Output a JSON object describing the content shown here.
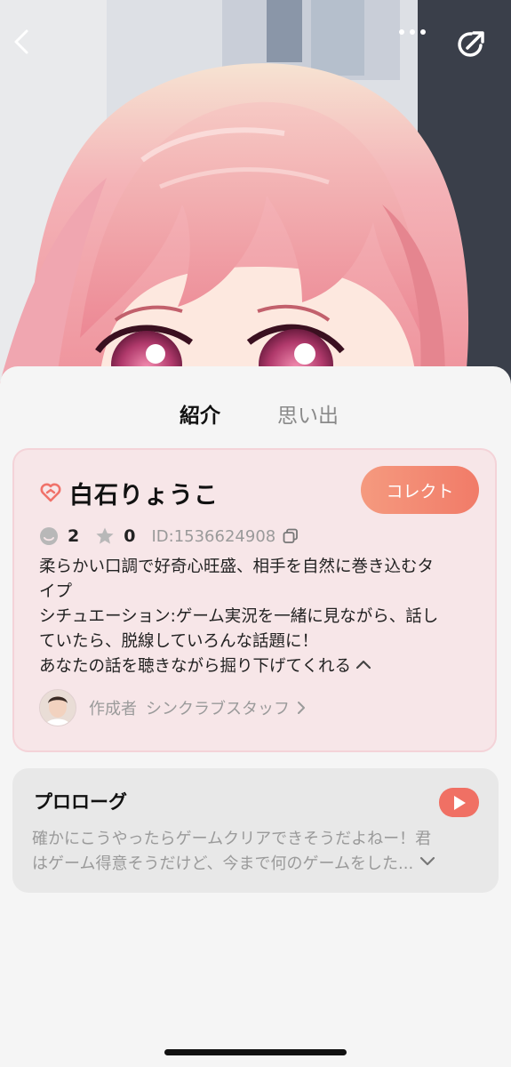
{
  "header": {
    "back_icon": "chevron-left-icon",
    "more_icon": "ellipsis-icon",
    "share_icon": "share-icon"
  },
  "tabs": [
    {
      "label": "紹介",
      "active": true
    },
    {
      "label": "思い出",
      "active": false
    }
  ],
  "character": {
    "name": "白石りょうこ",
    "collect_label": "コレクト",
    "chat_count": "2",
    "star_count": "0",
    "id_text": "ID:1536624908",
    "description_lines": [
      "柔らかい口調で好奇心旺盛、相手を自然に巻き込むタ",
      "イプ",
      "シチュエーション:ゲーム実況を一緒に見ながら、話し",
      "ていたら、脱線していろんな話題に！",
      "あなたの話を聴きながら掘り下げてくれる"
    ],
    "creator_label": "作成者",
    "creator_name": "シンクラブスタッフ"
  },
  "prologue": {
    "title": "プロローグ",
    "text_lines": [
      "確かにこうやったらゲームクリアできそうだよねー！君",
      "はゲーム得意そうだけど、今まで何のゲームをした..."
    ]
  },
  "colors": {
    "accent": "#f0726a",
    "card_bg": "#f7e6e8",
    "prologue_bg": "#e8e8e8"
  }
}
